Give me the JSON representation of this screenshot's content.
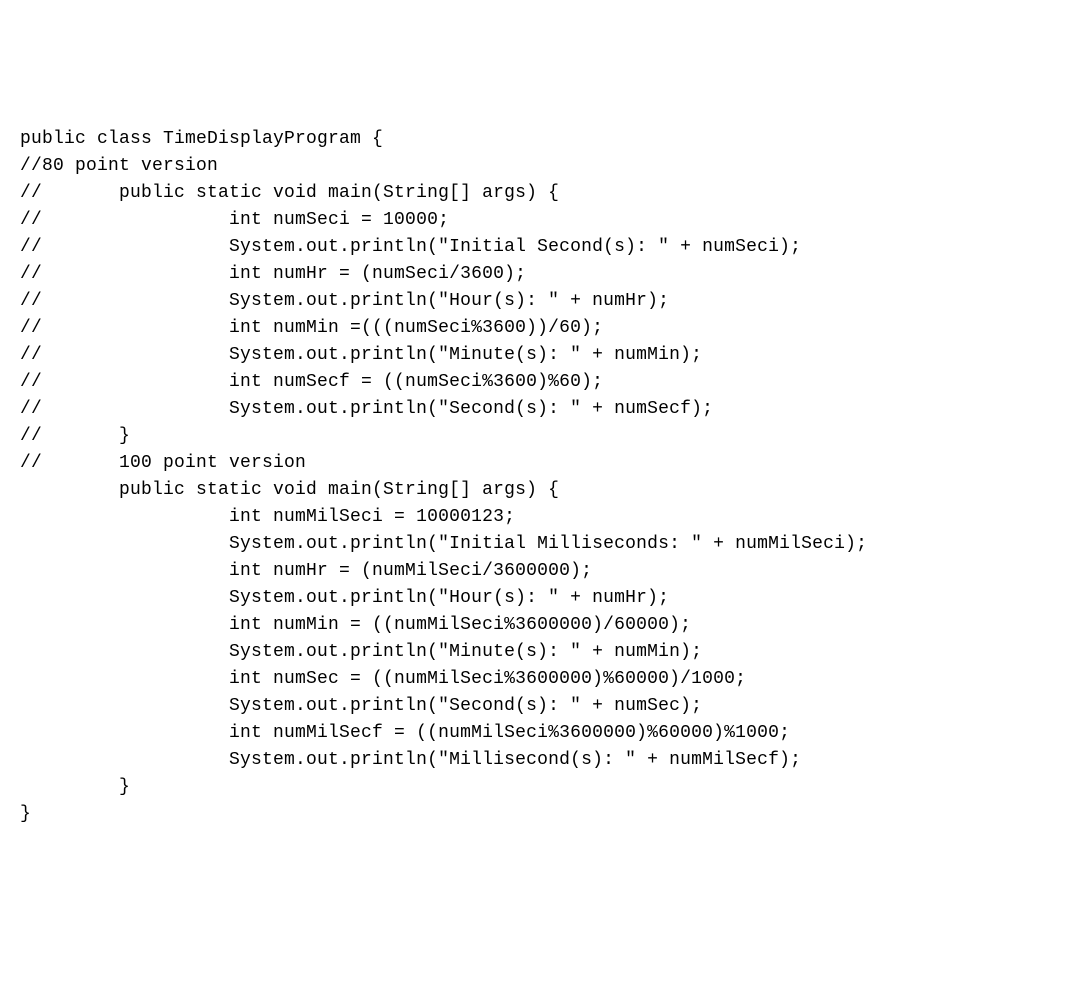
{
  "code": {
    "lines": [
      "public class TimeDisplayProgram {",
      "//80 point version",
      "//       public static void main(String[] args) {",
      "//                 int numSeci = 10000;",
      "//                 System.out.println(\"Initial Second(s): \" + numSeci);",
      "//                 int numHr = (numSeci/3600);",
      "//                 System.out.println(\"Hour(s): \" + numHr);",
      "//                 int numMin =(((numSeci%3600))/60);",
      "//                 System.out.println(\"Minute(s): \" + numMin);",
      "//                 int numSecf = ((numSeci%3600)%60);",
      "//                 System.out.println(\"Second(s): \" + numSecf);",
      "//       }",
      "",
      "//       100 point version",
      "         public static void main(String[] args) {",
      "                   int numMilSeci = 10000123;",
      "                   System.out.println(\"Initial Milliseconds: \" + numMilSeci);",
      "                   int numHr = (numMilSeci/3600000);",
      "                   System.out.println(\"Hour(s): \" + numHr);",
      "                   int numMin = ((numMilSeci%3600000)/60000);",
      "                   System.out.println(\"Minute(s): \" + numMin);",
      "                   int numSec = ((numMilSeci%3600000)%60000)/1000;",
      "                   System.out.println(\"Second(s): \" + numSec);",
      "                   int numMilSecf = ((numMilSeci%3600000)%60000)%1000;",
      "                   System.out.println(\"Millisecond(s): \" + numMilSecf);",
      "         }",
      "",
      "",
      "}"
    ]
  }
}
